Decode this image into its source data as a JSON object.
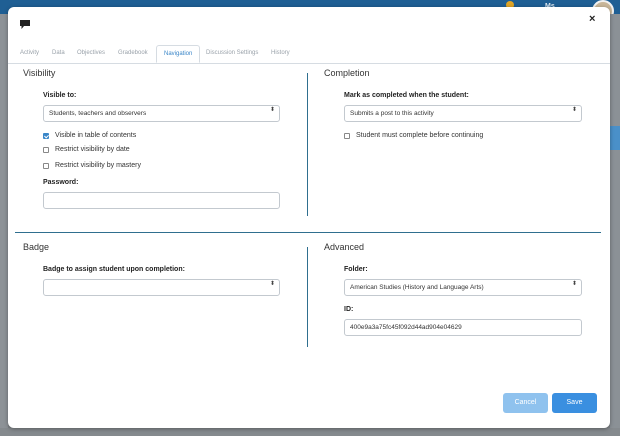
{
  "background": {
    "user_name": "Ms"
  },
  "tabs": [
    "Activity",
    "Data",
    "Objectives",
    "Gradebook",
    "Navigation",
    "Discussion Settings",
    "History"
  ],
  "active_tab": "Navigation",
  "visibility": {
    "title": "Visibility",
    "visible_to_label": "Visible to:",
    "visible_to_value": "Students, teachers and observers",
    "checkboxes": [
      {
        "label": "Visible in table of contents",
        "checked": true
      },
      {
        "label": "Restrict visibility by date",
        "checked": false
      },
      {
        "label": "Restrict visibility by mastery",
        "checked": false
      }
    ],
    "password_label": "Password:",
    "password_value": ""
  },
  "completion": {
    "title": "Completion",
    "mark_label": "Mark as completed when the student:",
    "mark_value": "Submits a post to this activity",
    "must_complete_label": "Student must complete before continuing",
    "must_complete_checked": false
  },
  "badge": {
    "title": "Badge",
    "assign_label": "Badge to assign student upon completion:",
    "assign_value": ""
  },
  "advanced": {
    "title": "Advanced",
    "folder_label": "Folder:",
    "folder_value": "American Studies (History and Language Arts)",
    "id_label": "ID:",
    "id_value": "400e9a3a75fc45f092d44ad904e04629"
  },
  "buttons": {
    "cancel": "Cancel",
    "save": "Save"
  },
  "close_glyph": "×",
  "caret_glyph": "⬍",
  "colors": {
    "accent": "#3a8fe0",
    "divider": "#2f6f8f",
    "cancel": "#8fc2ee"
  }
}
